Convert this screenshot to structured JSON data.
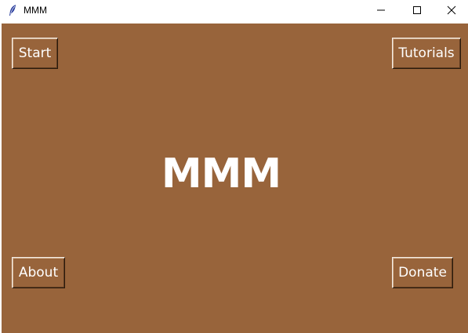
{
  "window": {
    "title": "MMM",
    "icons": {
      "app": "feather-icon",
      "minimize": "minimize-icon",
      "maximize": "maximize-icon",
      "close": "close-icon"
    }
  },
  "main": {
    "heading": "MMM",
    "buttons": {
      "start": "Start",
      "tutorials": "Tutorials",
      "about": "About",
      "donate": "Donate"
    }
  },
  "colors": {
    "background": "#98643b",
    "text": "#ffffff",
    "titlebar": "#ffffff"
  }
}
